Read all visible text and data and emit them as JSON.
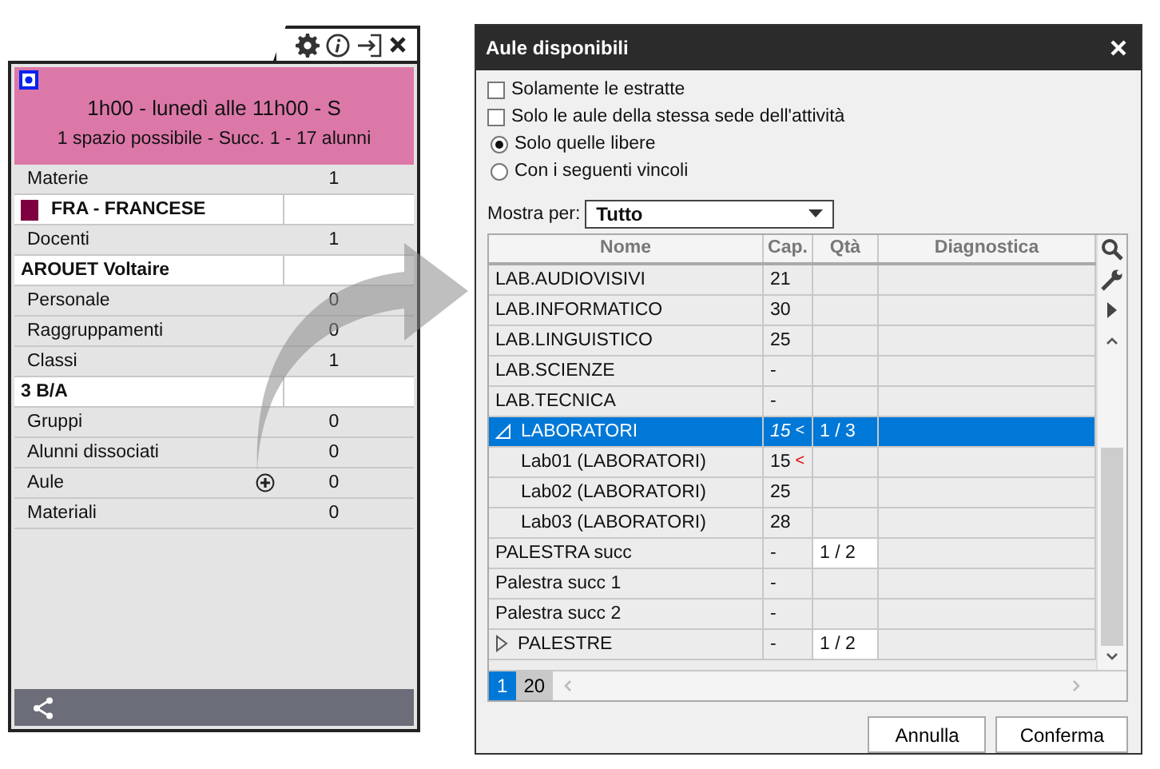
{
  "card": {
    "header_lines": [
      "1h00  -  lunedì alle 11h00  -  S",
      "1 spazio possibile  -  Succ. 1  -  17 alunni"
    ],
    "rows": [
      {
        "kind": "category",
        "label": "Materie",
        "count": "1"
      },
      {
        "kind": "item",
        "label": "FRA - FRANCESE",
        "color": "#7f0040"
      },
      {
        "kind": "category",
        "label": "Docenti",
        "count": "1"
      },
      {
        "kind": "item",
        "label": "AROUET Voltaire"
      },
      {
        "kind": "category",
        "label": "Personale",
        "count": "0"
      },
      {
        "kind": "category",
        "label": "Raggruppamenti",
        "count": "0"
      },
      {
        "kind": "category",
        "label": "Classi",
        "count": "1"
      },
      {
        "kind": "item",
        "label": "3 B/A"
      },
      {
        "kind": "category",
        "label": "Gruppi",
        "count": "0"
      },
      {
        "kind": "category",
        "label": "Alunni dissociati",
        "count": "0"
      },
      {
        "kind": "category",
        "label": "Aule",
        "count": "0",
        "add": true
      },
      {
        "kind": "category",
        "label": "Materiali",
        "count": "0"
      }
    ]
  },
  "dialog": {
    "title": "Aule disponibili",
    "checkboxes": [
      {
        "label": "Solamente le estratte",
        "checked": false
      },
      {
        "label": "Solo le aule della stessa sede dell'attività",
        "checked": false
      }
    ],
    "radios": [
      {
        "label": "Solo quelle libere",
        "selected": true
      },
      {
        "label": "Con i seguenti vincoli",
        "selected": false
      }
    ],
    "show_by": {
      "label": "Mostra per:",
      "value": "Tutto"
    },
    "table": {
      "columns": [
        "Nome",
        "Cap.",
        "Qtà",
        "Diagnostica"
      ],
      "rows": [
        {
          "name": "LAB.AUDIOVISIVI",
          "cap": "21",
          "selected": false
        },
        {
          "name": "LAB.INFORMATICO",
          "cap": "30",
          "selected": false
        },
        {
          "name": "LAB.LINGUISTICO",
          "cap": "25",
          "selected": false
        },
        {
          "name": "LAB.SCIENZE",
          "cap": "-",
          "selected": false
        },
        {
          "name": "LAB.TECNICA",
          "cap": "-",
          "selected": false
        },
        {
          "name": "LABORATORI",
          "cap": "15",
          "cap_flag": "<",
          "qta": "1 / 3",
          "selected": true,
          "expanded": true,
          "children": [
            {
              "name": "Lab01 (LABORATORI)",
              "cap": "15",
              "cap_flag": "<",
              "selected": false
            },
            {
              "name": "Lab02 (LABORATORI)",
              "cap": "25",
              "selected": false
            },
            {
              "name": "Lab03 (LABORATORI)",
              "cap": "28",
              "selected": false
            }
          ]
        },
        {
          "name": "PALESTRA succ",
          "cap": "-",
          "qta": "1 / 2",
          "selected": false
        },
        {
          "name": "Palestra succ 1",
          "cap": "-",
          "selected": false
        },
        {
          "name": "Palestra succ 2",
          "cap": "-",
          "selected": false
        },
        {
          "name": "PALESTRE",
          "cap": "-",
          "qta": "1 / 2",
          "selected": false,
          "expanded": false
        }
      ]
    },
    "pages": [
      {
        "label": "1",
        "selected": true
      },
      {
        "label": "20",
        "selected": false
      }
    ],
    "buttons": [
      "Annulla",
      "Conferma"
    ]
  }
}
